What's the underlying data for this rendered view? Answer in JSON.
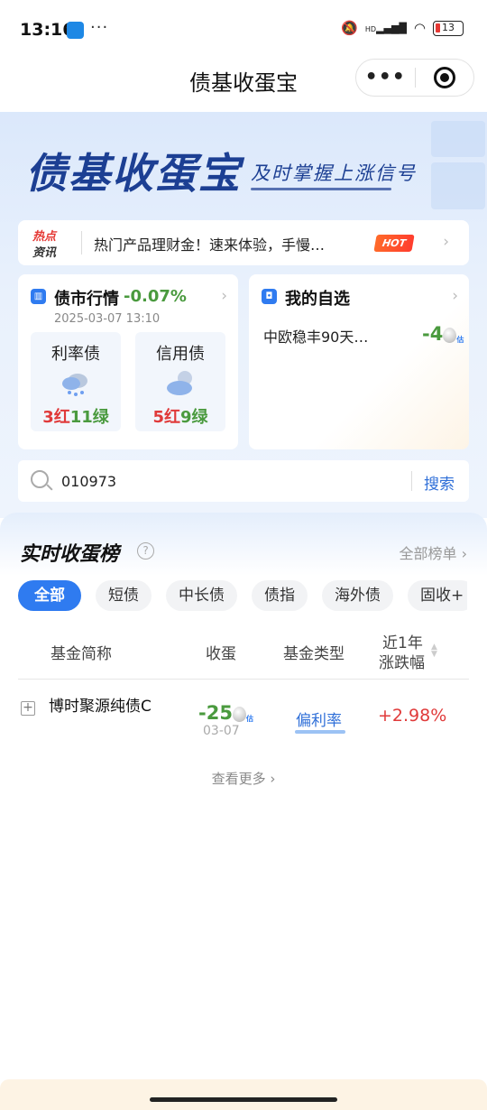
{
  "status_bar": {
    "time": "13:16",
    "dots": "···",
    "hd": "HD",
    "battery": "13"
  },
  "nav": {
    "title": "债基收蛋宝",
    "more": "•••"
  },
  "hero": {
    "logo": "债基收蛋宝",
    "slogan": "及时掌握上涨信号"
  },
  "news": {
    "tag_line1": "热点",
    "tag_line2": "资讯",
    "text": "热门产品理财金！速来体验，手慢…",
    "badge": "HOT"
  },
  "market": {
    "title": "债市行情",
    "change": "-0.07%",
    "date": "2025-03-07 13:10",
    "items": [
      {
        "label": "利率债",
        "red": "3红",
        "green": "11绿",
        "weather": "rain-cloud-icon"
      },
      {
        "label": "信用债",
        "red": "5红",
        "green": "9绿",
        "weather": "cloud-moon-icon"
      }
    ]
  },
  "watchlist": {
    "title": "我的自选",
    "item_name": "中欧稳丰90天…",
    "item_value": "-4",
    "est": "估"
  },
  "search": {
    "value": "010973",
    "button": "搜索"
  },
  "ranking": {
    "title": "实时收蛋榜",
    "all_link": "全部榜单",
    "tabs": [
      "全部",
      "短债",
      "中长债",
      "债指",
      "海外债",
      "固收+"
    ],
    "columns": {
      "name": "基金简称",
      "egg": "收蛋",
      "type": "基金类型",
      "change_line1": "近1年",
      "change_line2": "涨跌幅"
    },
    "rows": [
      {
        "name": "博时聚源纯债C",
        "egg": "-25",
        "est": "估",
        "date": "03-07",
        "type": "偏利率",
        "change": "+2.98%"
      }
    ],
    "see_more": "查看更多"
  },
  "colors": {
    "accent": "#2f7bf0",
    "red": "#e03a3a",
    "green": "#4a9a3e",
    "brand_navy": "#1c3f93"
  }
}
